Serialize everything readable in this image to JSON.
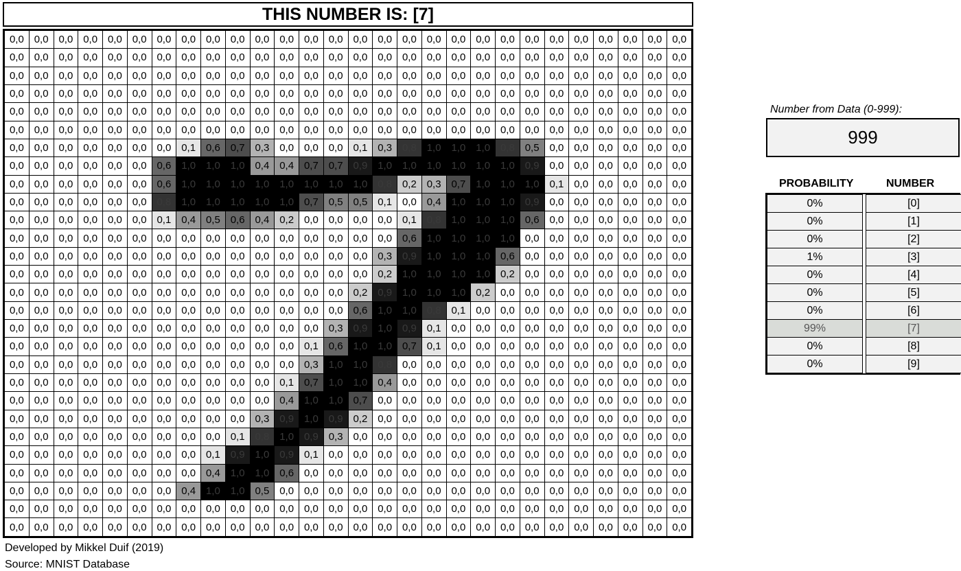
{
  "title": "THIS NUMBER IS: [7]",
  "grid": {
    "rows": [
      [
        0,
        0,
        0,
        0,
        0,
        0,
        0,
        0,
        0,
        0,
        0,
        0,
        0,
        0,
        0,
        0,
        0,
        0,
        0,
        0,
        0,
        0,
        0,
        0,
        0,
        0,
        0,
        0
      ],
      [
        0,
        0,
        0,
        0,
        0,
        0,
        0,
        0,
        0,
        0,
        0,
        0,
        0,
        0,
        0,
        0,
        0,
        0,
        0,
        0,
        0,
        0,
        0,
        0,
        0,
        0,
        0,
        0
      ],
      [
        0,
        0,
        0,
        0,
        0,
        0,
        0,
        0,
        0,
        0,
        0,
        0,
        0,
        0,
        0,
        0,
        0,
        0,
        0,
        0,
        0,
        0,
        0,
        0,
        0,
        0,
        0,
        0
      ],
      [
        0,
        0,
        0,
        0,
        0,
        0,
        0,
        0,
        0,
        0,
        0,
        0,
        0,
        0,
        0,
        0,
        0,
        0,
        0,
        0,
        0,
        0,
        0,
        0,
        0,
        0,
        0,
        0
      ],
      [
        0,
        0,
        0,
        0,
        0,
        0,
        0,
        0,
        0,
        0,
        0,
        0,
        0,
        0,
        0,
        0,
        0,
        0,
        0,
        0,
        0,
        0,
        0,
        0,
        0,
        0,
        0,
        0
      ],
      [
        0,
        0,
        0,
        0,
        0,
        0,
        0,
        0,
        0,
        0,
        0,
        0,
        0,
        0,
        0,
        0,
        0,
        0,
        0,
        0,
        0,
        0,
        0,
        0,
        0,
        0,
        0,
        0
      ],
      [
        0,
        0,
        0,
        0,
        0,
        0,
        0,
        0.1,
        0.6,
        0.7,
        0.3,
        0,
        0,
        0,
        0.1,
        0.3,
        0.8,
        1,
        1,
        1,
        0.8,
        0.5,
        0,
        0,
        0,
        0,
        0,
        0
      ],
      [
        0,
        0,
        0,
        0,
        0,
        0,
        0.6,
        1,
        1,
        1,
        0.4,
        0.4,
        0.7,
        0.7,
        0.9,
        1,
        1,
        1,
        1,
        1,
        1,
        0.9,
        0,
        0,
        0,
        0,
        0,
        0
      ],
      [
        0,
        0,
        0,
        0,
        0,
        0,
        0.6,
        1,
        1,
        1,
        1,
        1,
        1,
        1,
        1,
        0.8,
        0.2,
        0.3,
        0.7,
        1,
        1,
        1,
        0.1,
        0,
        0,
        0,
        0,
        0
      ],
      [
        0,
        0,
        0,
        0,
        0,
        0,
        0.8,
        1,
        1,
        1,
        1,
        1,
        0.7,
        0.5,
        0.5,
        0.1,
        0,
        0.4,
        1,
        1,
        1,
        0.9,
        0,
        0,
        0,
        0,
        0,
        0
      ],
      [
        0,
        0,
        0,
        0,
        0,
        0,
        0.1,
        0.4,
        0.5,
        0.6,
        0.4,
        0.2,
        0,
        0,
        0,
        0,
        0.1,
        0.8,
        1,
        1,
        1,
        0.6,
        0,
        0,
        0,
        0,
        0,
        0
      ],
      [
        0,
        0,
        0,
        0,
        0,
        0,
        0,
        0,
        0,
        0,
        0,
        0,
        0,
        0,
        0,
        0,
        0.6,
        1,
        1,
        1,
        1,
        0,
        0,
        0,
        0,
        0,
        0,
        0
      ],
      [
        0,
        0,
        0,
        0,
        0,
        0,
        0,
        0,
        0,
        0,
        0,
        0,
        0,
        0,
        0,
        0.3,
        0.9,
        1,
        1,
        1,
        0.6,
        0,
        0,
        0,
        0,
        0,
        0,
        0
      ],
      [
        0,
        0,
        0,
        0,
        0,
        0,
        0,
        0,
        0,
        0,
        0,
        0,
        0,
        0,
        0,
        0.2,
        1,
        1,
        1,
        1,
        0.2,
        0,
        0,
        0,
        0,
        0,
        0,
        0
      ],
      [
        0,
        0,
        0,
        0,
        0,
        0,
        0,
        0,
        0,
        0,
        0,
        0,
        0,
        0,
        0.2,
        0.9,
        1,
        1,
        1,
        0.2,
        0,
        0,
        0,
        0,
        0,
        0,
        0,
        0
      ],
      [
        0,
        0,
        0,
        0,
        0,
        0,
        0,
        0,
        0,
        0,
        0,
        0,
        0,
        0,
        0.6,
        1,
        1,
        0.8,
        0.1,
        0,
        0,
        0,
        0,
        0,
        0,
        0,
        0,
        0
      ],
      [
        0,
        0,
        0,
        0,
        0,
        0,
        0,
        0,
        0,
        0,
        0,
        0,
        0,
        0.3,
        0.9,
        1,
        0.9,
        0.1,
        0,
        0,
        0,
        0,
        0,
        0,
        0,
        0,
        0,
        0
      ],
      [
        0,
        0,
        0,
        0,
        0,
        0,
        0,
        0,
        0,
        0,
        0,
        0,
        0.1,
        0.6,
        1,
        1,
        0.7,
        0.1,
        0,
        0,
        0,
        0,
        0,
        0,
        0,
        0,
        0,
        0
      ],
      [
        0,
        0,
        0,
        0,
        0,
        0,
        0,
        0,
        0,
        0,
        0,
        0,
        0.3,
        1,
        1,
        0.8,
        0,
        0,
        0,
        0,
        0,
        0,
        0,
        0,
        0,
        0,
        0,
        0
      ],
      [
        0,
        0,
        0,
        0,
        0,
        0,
        0,
        0,
        0,
        0,
        0,
        0.1,
        0.7,
        1,
        1,
        0.4,
        0,
        0,
        0,
        0,
        0,
        0,
        0,
        0,
        0,
        0,
        0,
        0
      ],
      [
        0,
        0,
        0,
        0,
        0,
        0,
        0,
        0,
        0,
        0,
        0,
        0.4,
        1,
        1,
        0.7,
        0,
        0,
        0,
        0,
        0,
        0,
        0,
        0,
        0,
        0,
        0,
        0,
        0
      ],
      [
        0,
        0,
        0,
        0,
        0,
        0,
        0,
        0,
        0,
        0,
        0.3,
        0.9,
        1,
        0.9,
        0.2,
        0,
        0,
        0,
        0,
        0,
        0,
        0,
        0,
        0,
        0,
        0,
        0,
        0
      ],
      [
        0,
        0,
        0,
        0,
        0,
        0,
        0,
        0,
        0,
        0.1,
        0.8,
        1,
        0.9,
        0.3,
        0,
        0,
        0,
        0,
        0,
        0,
        0,
        0,
        0,
        0,
        0,
        0,
        0,
        0
      ],
      [
        0,
        0,
        0,
        0,
        0,
        0,
        0,
        0,
        0.1,
        0.9,
        1,
        0.9,
        0.1,
        0,
        0,
        0,
        0,
        0,
        0,
        0,
        0,
        0,
        0,
        0,
        0,
        0,
        0,
        0
      ],
      [
        0,
        0,
        0,
        0,
        0,
        0,
        0,
        0,
        0.4,
        1,
        1,
        0.6,
        0,
        0,
        0,
        0,
        0,
        0,
        0,
        0,
        0,
        0,
        0,
        0,
        0,
        0,
        0,
        0
      ],
      [
        0,
        0,
        0,
        0,
        0,
        0,
        0,
        0.4,
        1,
        1,
        0.5,
        0,
        0,
        0,
        0,
        0,
        0,
        0,
        0,
        0,
        0,
        0,
        0,
        0,
        0,
        0,
        0,
        0
      ],
      [
        0,
        0,
        0,
        0,
        0,
        0,
        0,
        0,
        0,
        0,
        0,
        0,
        0,
        0,
        0,
        0,
        0,
        0,
        0,
        0,
        0,
        0,
        0,
        0,
        0,
        0,
        0,
        0
      ],
      [
        0,
        0,
        0,
        0,
        0,
        0,
        0,
        0,
        0,
        0,
        0,
        0,
        0,
        0,
        0,
        0,
        0,
        0,
        0,
        0,
        0,
        0,
        0,
        0,
        0,
        0,
        0,
        0
      ]
    ]
  },
  "footer": {
    "developed": "Developed by Mikkel Duif (2019)",
    "source": "Source: MNIST Database"
  },
  "input": {
    "label": "Number from Data (0-999):",
    "value": "999"
  },
  "probabilities": {
    "header_probability": "PROBABILITY",
    "header_number": "NUMBER",
    "highlight_color": "#d9dcd8",
    "rows": [
      {
        "probability": "0%",
        "number": "[0]"
      },
      {
        "probability": "0%",
        "number": "[1]"
      },
      {
        "probability": "0%",
        "number": "[2]"
      },
      {
        "probability": "1%",
        "number": "[3]"
      },
      {
        "probability": "0%",
        "number": "[4]"
      },
      {
        "probability": "0%",
        "number": "[5]"
      },
      {
        "probability": "0%",
        "number": "[6]"
      },
      {
        "probability": "99%",
        "number": "[7]",
        "highlight": true
      },
      {
        "probability": "0%",
        "number": "[8]"
      },
      {
        "probability": "0%",
        "number": "[9]"
      }
    ]
  }
}
